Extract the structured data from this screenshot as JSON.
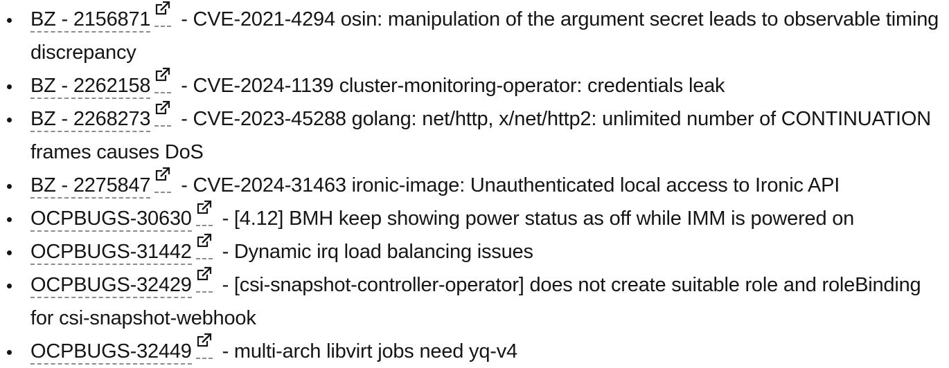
{
  "items": [
    {
      "link": "BZ - 2156871",
      "icon": "external-link-icon",
      "separator": "-",
      "text": "CVE-2021-4294 osin: manipulation of the argument secret leads to observable timing discrepancy"
    },
    {
      "link": "BZ - 2262158",
      "icon": "external-link-icon",
      "separator": "-",
      "text": "CVE-2024-1139 cluster-monitoring-operator: credentials leak"
    },
    {
      "link": "BZ - 2268273",
      "icon": "external-link-icon",
      "separator": "-",
      "text": "CVE-2023-45288 golang: net/http, x/net/http2: unlimited number of CONTINUATION frames causes DoS"
    },
    {
      "link": "BZ - 2275847",
      "icon": "external-link-icon",
      "separator": "-",
      "text": "CVE-2024-31463 ironic-image: Unauthenticated local access to Ironic API"
    },
    {
      "link": "OCPBUGS-30630",
      "icon": "external-link-icon",
      "separator": "-",
      "text": "[4.12] BMH keep showing power status as off while IMM is powered on"
    },
    {
      "link": "OCPBUGS-31442",
      "icon": "external-link-icon",
      "separator": "-",
      "text": "Dynamic irq load balancing issues"
    },
    {
      "link": "OCPBUGS-32429",
      "icon": "external-link-icon",
      "separator": "-",
      "text": "[csi-snapshot-controller-operator] does not create suitable role and roleBinding for csi-snapshot-webhook"
    },
    {
      "link": "OCPBUGS-32449",
      "icon": "external-link-icon",
      "separator": "-",
      "text": "multi-arch libvirt jobs need yq-v4"
    }
  ]
}
